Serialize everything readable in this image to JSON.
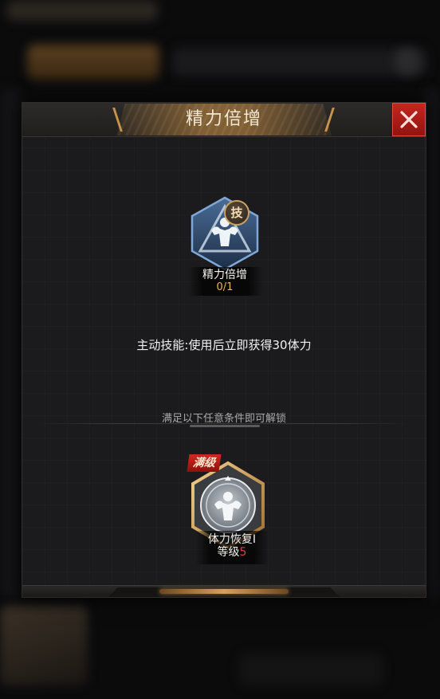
{
  "dialog": {
    "title": "精力倍增",
    "close_icon": "close-icon"
  },
  "skill": {
    "icon": "muscle-flex-icon",
    "tag": "技",
    "name": "精力倍增",
    "count": "0/1",
    "description": "主动技能:使用后立即获得30体力"
  },
  "unlock": {
    "label": "满足以下任意条件即可解锁"
  },
  "requirement": {
    "icon": "muscle-flex-icon",
    "badge": "满级",
    "name": "体力恢复I",
    "level_prefix": "等级",
    "level_value": "5"
  },
  "colors": {
    "accent_gold": "#c8934a",
    "close_red": "#c7261f",
    "count_gold": "#e9b84d",
    "level_red": "#e0413a"
  }
}
